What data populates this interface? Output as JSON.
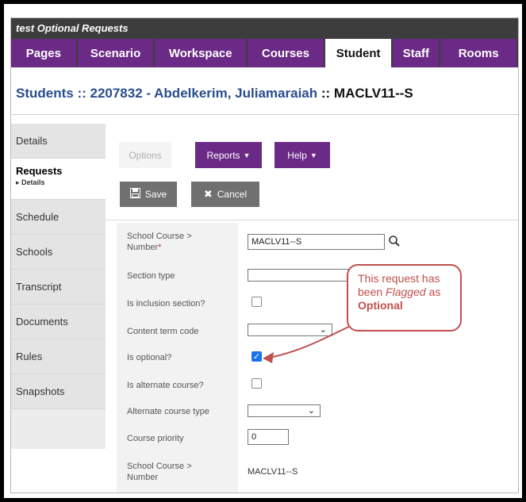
{
  "window": {
    "title": "test Optional Requests"
  },
  "topnav": {
    "tabs": [
      {
        "label": "Pages"
      },
      {
        "label": "Scenario"
      },
      {
        "label": "Workspace"
      },
      {
        "label": "Courses"
      },
      {
        "label": "Student",
        "active": true
      },
      {
        "label": "Staff"
      },
      {
        "label": "Rooms"
      }
    ]
  },
  "heading": {
    "prefix": "Students :: 2207832 - Abdelkerim, Juliamaraiah",
    "separator": " :: ",
    "course": "MACLV11--S"
  },
  "sidenav": {
    "items": [
      {
        "label": "Details"
      },
      {
        "label": "Requests",
        "sub": "▸ Details",
        "active": true
      },
      {
        "label": "Schedule"
      },
      {
        "label": "Schools"
      },
      {
        "label": "Transcript"
      },
      {
        "label": "Documents"
      },
      {
        "label": "Rules"
      },
      {
        "label": "Snapshots"
      }
    ]
  },
  "toolbar": {
    "options_label": "Options",
    "reports_label": "Reports",
    "help_label": "Help",
    "save_label": "Save",
    "cancel_label": "Cancel"
  },
  "form": {
    "school_course_number_label": "School Course > Number",
    "school_course_number_value": "MACLV11--S",
    "section_type_label": "Section type",
    "section_type_value": "",
    "is_inclusion_section_label": "Is inclusion section?",
    "is_inclusion_section_checked": false,
    "content_term_code_label": "Content term code",
    "content_term_code_value": "",
    "is_optional_label": "Is optional?",
    "is_optional_checked": true,
    "is_alternate_course_label": "Is alternate course?",
    "is_alternate_course_checked": false,
    "alternate_course_type_label": "Alternate course type",
    "alternate_course_type_value": "",
    "course_priority_label": "Course priority",
    "course_priority_value": "0",
    "school_course_number_ro_label": "School Course > Number",
    "school_course_number_ro_value": "MACLV11--S"
  },
  "callout": {
    "line1": "This request has",
    "line2_pre": "been ",
    "line2_em": "Flagged",
    "line2_post": " as",
    "line3": "Optional"
  },
  "colors": {
    "accent_purple": "#6b2a86",
    "nav_dark": "#3d3d3d",
    "heading_blue": "#2a4e8c",
    "callout_red": "#c0504d",
    "checkbox_blue": "#1a73e8"
  }
}
